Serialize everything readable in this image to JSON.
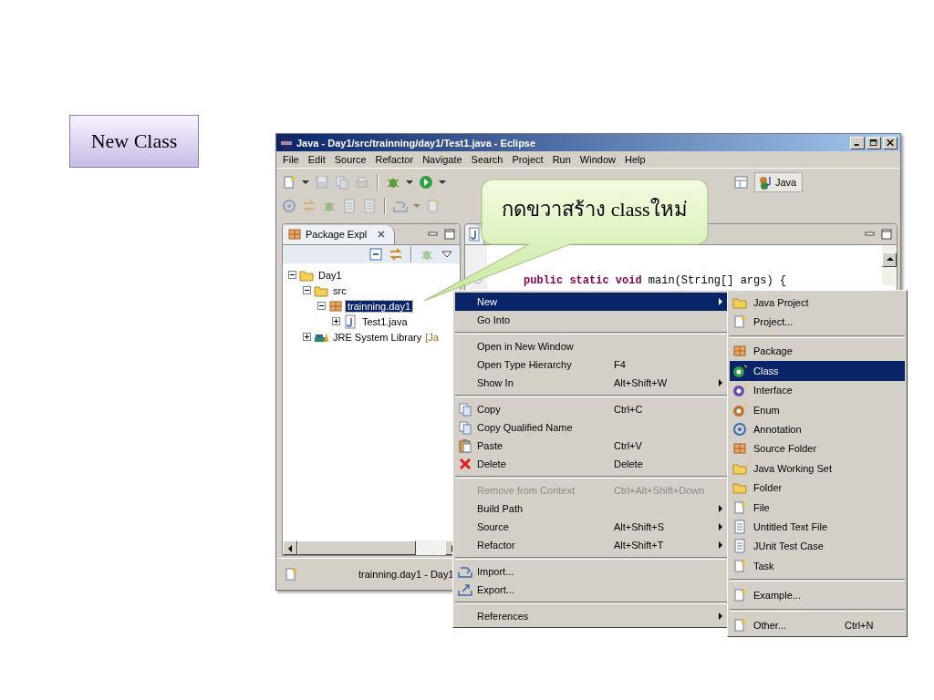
{
  "slide_title": "New Class",
  "window": {
    "title": "Java - Day1/src/trainning/day1/Test1.java - Eclipse",
    "menu": [
      "File",
      "Edit",
      "Source",
      "Refactor",
      "Navigate",
      "Search",
      "Project",
      "Run",
      "Window",
      "Help"
    ],
    "perspective": "Java"
  },
  "package_explorer": {
    "tab": "Package Expl",
    "tree": [
      {
        "label": "Day1",
        "expanded": true,
        "selected": false,
        "children": [
          {
            "label": "src",
            "expanded": true,
            "selected": false,
            "children": [
              {
                "label": "trainning.day1",
                "expanded": true,
                "selected": true,
                "children": [
                  {
                    "label": "Test1.java",
                    "expanded": false,
                    "selected": false
                  }
                ]
              }
            ]
          },
          {
            "label": "JRE System Library",
            "decoration": "[Ja",
            "expanded": false,
            "selected": false
          }
        ]
      }
    ]
  },
  "editor": {
    "code": [
      "**public static void** main(String[] args) {"
    ]
  },
  "status_bar": {
    "text": "trainning.day1 - Day1"
  },
  "callout": {
    "text": "กดขวาสร้าง classใหม่"
  },
  "context_menu": {
    "items": [
      {
        "kind": "item",
        "label": "New",
        "submenu": true,
        "selected": true,
        "disabled": false
      },
      {
        "kind": "item",
        "label": "Go Into",
        "submenu": false,
        "selected": false,
        "disabled": false
      },
      {
        "kind": "separator"
      },
      {
        "kind": "item",
        "label": "Open in New Window",
        "submenu": false,
        "selected": false,
        "disabled": false
      },
      {
        "kind": "item",
        "label": "Open Type Hierarchy",
        "shortcut": "F4",
        "submenu": false,
        "selected": false,
        "disabled": false
      },
      {
        "kind": "item",
        "label": "Show In",
        "shortcut": "Alt+Shift+W",
        "submenu": true,
        "selected": false,
        "disabled": false
      },
      {
        "kind": "separator"
      },
      {
        "kind": "item",
        "label": "Copy",
        "shortcut": "Ctrl+C",
        "submenu": false,
        "selected": false,
        "disabled": false
      },
      {
        "kind": "item",
        "label": "Copy Qualified Name",
        "submenu": false,
        "selected": false,
        "disabled": false
      },
      {
        "kind": "item",
        "label": "Paste",
        "shortcut": "Ctrl+V",
        "submenu": false,
        "selected": false,
        "disabled": false
      },
      {
        "kind": "item",
        "label": "Delete",
        "shortcut": "Delete",
        "submenu": false,
        "selected": false,
        "disabled": false
      },
      {
        "kind": "separator"
      },
      {
        "kind": "item",
        "label": "Remove from Context",
        "shortcut": "Ctrl+Alt+Shift+Down",
        "submenu": false,
        "selected": false,
        "disabled": true
      },
      {
        "kind": "item",
        "label": "Build Path",
        "submenu": true,
        "selected": false,
        "disabled": false
      },
      {
        "kind": "item",
        "label": "Source",
        "shortcut": "Alt+Shift+S",
        "submenu": true,
        "selected": false,
        "disabled": false
      },
      {
        "kind": "item",
        "label": "Refactor",
        "shortcut": "Alt+Shift+T",
        "submenu": true,
        "selected": false,
        "disabled": false
      },
      {
        "kind": "separator"
      },
      {
        "kind": "item",
        "label": "Import...",
        "submenu": false,
        "selected": false,
        "disabled": false
      },
      {
        "kind": "item",
        "label": "Export...",
        "submenu": false,
        "selected": false,
        "disabled": false
      },
      {
        "kind": "separator"
      },
      {
        "kind": "item",
        "label": "References",
        "submenu": true,
        "selected": false,
        "disabled": false
      }
    ]
  },
  "submenu": {
    "items": [
      {
        "kind": "item",
        "label": "Java Project",
        "selected": false
      },
      {
        "kind": "item",
        "label": "Project...",
        "selected": false
      },
      {
        "kind": "separator"
      },
      {
        "kind": "item",
        "label": "Package",
        "selected": false
      },
      {
        "kind": "item",
        "label": "Class",
        "selected": true
      },
      {
        "kind": "item",
        "label": "Interface",
        "selected": false
      },
      {
        "kind": "item",
        "label": "Enum",
        "selected": false
      },
      {
        "kind": "item",
        "label": "Annotation",
        "selected": false
      },
      {
        "kind": "item",
        "label": "Source Folder",
        "selected": false
      },
      {
        "kind": "item",
        "label": "Java Working Set",
        "selected": false
      },
      {
        "kind": "item",
        "label": "Folder",
        "selected": false
      },
      {
        "kind": "item",
        "label": "File",
        "selected": false
      },
      {
        "kind": "item",
        "label": "Untitled Text File",
        "selected": false
      },
      {
        "kind": "item",
        "label": "JUnit Test Case",
        "selected": false
      },
      {
        "kind": "item",
        "label": "Task",
        "selected": false
      },
      {
        "kind": "separator"
      },
      {
        "kind": "item",
        "label": "Example...",
        "selected": false
      },
      {
        "kind": "separator"
      },
      {
        "kind": "item",
        "label": "Other...",
        "shortcut": "Ctrl+N",
        "selected": false
      }
    ]
  }
}
